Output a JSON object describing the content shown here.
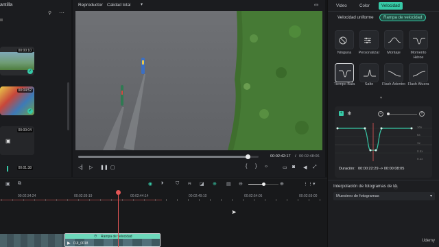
{
  "left_panel": {
    "title_fragment": "antilla",
    "clips": [
      {
        "duration": "00:00:10",
        "checked": true
      },
      {
        "duration": "00:04:52",
        "checked": true
      },
      {
        "duration": "00:00:04",
        "checked": false
      },
      {
        "duration": "00:01:38",
        "checked": false
      }
    ]
  },
  "player": {
    "tab_label": "Reproductor",
    "quality": "Calidad total",
    "current_time": "00:02:42:17",
    "separator": "/",
    "total_time": "00:02:48:06",
    "progress": 0.94
  },
  "right_panel": {
    "tabs": [
      "Video",
      "Color",
      "Velocidad"
    ],
    "active_tab": "Velocidad",
    "subtabs": [
      "Velocidad uniforme",
      "Rampa de velocidad"
    ],
    "active_subtab": "Rampa de velocidad",
    "presets": [
      {
        "label": "Ninguna",
        "icon": "none-icon"
      },
      {
        "label": "Personalizar",
        "icon": "customize-icon"
      },
      {
        "label": "Montaje",
        "icon": "montage-icon"
      },
      {
        "label": "Momento Héroe",
        "icon": "hero-moment-icon"
      },
      {
        "label": "Tiempo Bala",
        "icon": "bullet-time-icon"
      },
      {
        "label": "Salto",
        "icon": "jump-icon"
      },
      {
        "label": "Flash Adentro",
        "icon": "flash-in-icon"
      },
      {
        "label": "Flash Afuera",
        "icon": "flash-out-icon"
      }
    ],
    "selected_preset": "Tiempo Bala",
    "curve_axis": [
      "10x",
      "5x",
      "1x",
      "0.5x",
      "0.1x"
    ],
    "duration_label": "Duración:",
    "duration_value": "00:00:22:29 -> 00:00:08:05",
    "interp_label": "Interpolación de fotogramas de IA",
    "interp_value": "Muestreo de fotogramas"
  },
  "timeline": {
    "ticks": [
      "00:02:34:24",
      "00:02:39:19",
      "00:02:44:14",
      "00:02:49:10",
      "00:02:54:05",
      "00:02:59:00"
    ],
    "clip_label": "Rampa de velocidad",
    "clip_name": "DJI_0018",
    "watermark": "Udemy"
  },
  "colors": {
    "accent": "#37c9a7",
    "playhead": "#e35656",
    "background": "#141517"
  }
}
